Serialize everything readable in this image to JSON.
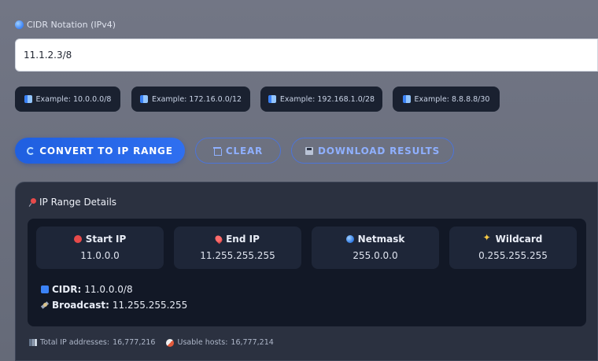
{
  "input": {
    "label": "CIDR Notation (IPv4)",
    "value": "11.1.2.3/8"
  },
  "examples": [
    {
      "label": "Example: 10.0.0.0/8",
      "icon": "book-icon"
    },
    {
      "label": "Example: 172.16.0.0/12",
      "icon": "book-icon"
    },
    {
      "label": "Example: 192.168.1.0/28",
      "icon": "book-icon"
    },
    {
      "label": "Example: 8.8.8.8/30",
      "icon": "book-icon"
    }
  ],
  "actions": {
    "convert": "CONVERT TO IP RANGE",
    "clear": "CLEAR",
    "download": "DOWNLOAD RESULTS"
  },
  "results": {
    "title": "IP Range Details",
    "cards": [
      {
        "label": "Start IP",
        "value": "11.0.0.0",
        "icon": "pushpin-icon"
      },
      {
        "label": "End IP",
        "value": "11.255.255.255",
        "icon": "location-pin-icon"
      },
      {
        "label": "Netmask",
        "value": "255.0.0.0",
        "icon": "globe-icon"
      },
      {
        "label": "Wildcard",
        "value": "0.255.255.255",
        "icon": "sparkles-icon"
      }
    ],
    "cidr_label": "CIDR:",
    "cidr_value": "11.0.0.0/8",
    "broadcast_label": "Broadcast:",
    "broadcast_value": "11.255.255.255",
    "total_label": "Total IP addresses:",
    "total_value": "16,777,216",
    "usable_label": "Usable hosts:",
    "usable_value": "16,777,214"
  },
  "colors": {
    "accent": "#2f6ff0",
    "background": "#6b6f7d",
    "card": "#1e2638"
  }
}
